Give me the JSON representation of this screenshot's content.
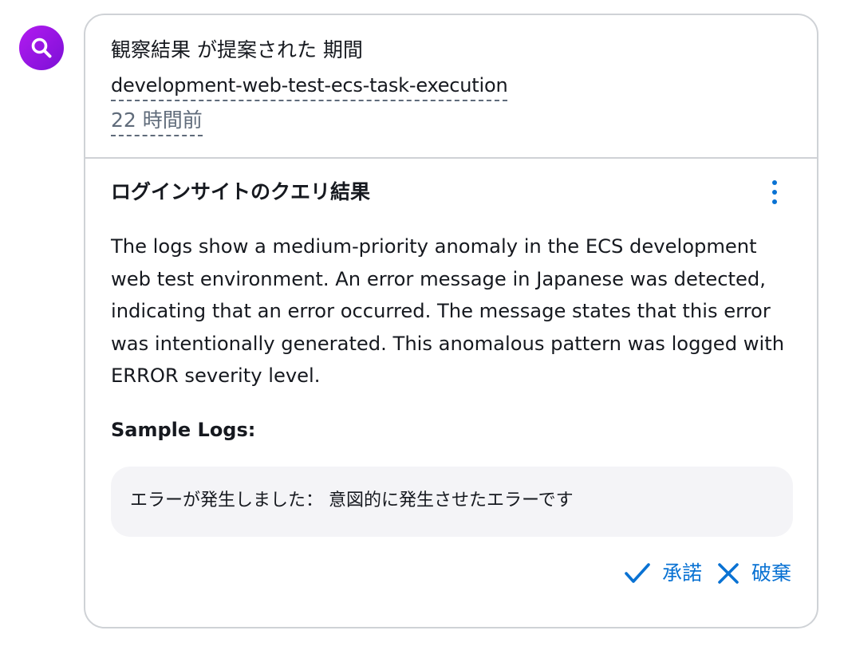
{
  "avatar": {
    "icon": "search-icon",
    "color": "#9b16e6"
  },
  "header": {
    "line1": "観察結果 が提案された 期間",
    "source_link": "development-web-test-ecs-task-execution",
    "time_ago": "22 時間前"
  },
  "insight": {
    "title": "ログインサイトのクエリ結果",
    "menu_icon": "more-vertical-icon",
    "description": "The logs show a medium-priority anomaly in the ECS development web test environment. An error message in Japanese was detected, indicating that an error occurred. The message states that this error was intentionally generated. This anomalous pattern was logged with ERROR severity level.",
    "sample_heading": "Sample Logs:",
    "sample_log": "エラーが発生しました： 意図的に発生させたエラーです"
  },
  "actions": {
    "accept_label": "承諾",
    "dismiss_label": "破棄",
    "accent_color": "#0972d3"
  }
}
